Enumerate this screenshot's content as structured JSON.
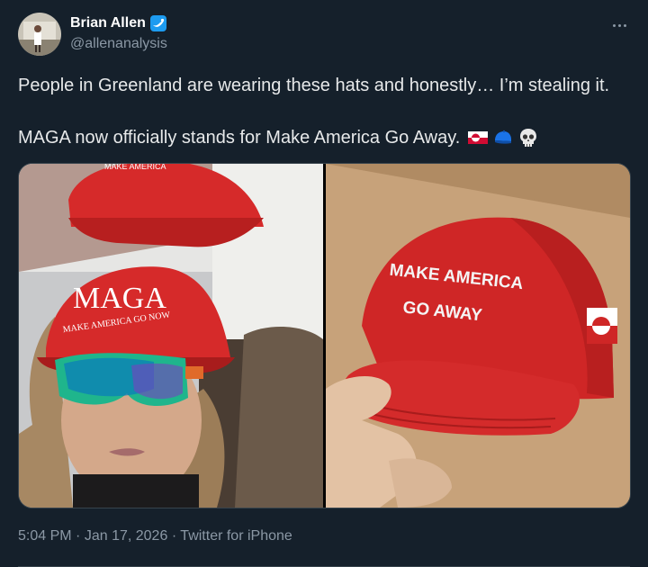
{
  "author": {
    "display_name": "Brian Allen",
    "handle": "@allenanalysis",
    "verified_icon": "verified-badge-icon",
    "accent": "#1d9bf0"
  },
  "tweet": {
    "line1": "People in Greenland are wearing these hats and honestly… I’m stealing it.",
    "line2": "MAGA now officially stands for Make America Go Away.",
    "emojis": [
      "greenland-flag-icon",
      "blue-cap-icon",
      "skull-icon"
    ]
  },
  "media": {
    "left_photo": {
      "hat_text_big": "MAGA",
      "hat_text_small": "MAKE AMERICA GO NOW"
    },
    "right_photo": {
      "hat_line1": "MAKE AMERICA",
      "hat_line2": "GO AWAY"
    }
  },
  "footer": {
    "time": "5:04 PM",
    "date": "Jan 17, 2026",
    "separator": "·",
    "source": "Twitter for iPhone"
  },
  "colors": {
    "background": "#15202b",
    "text": "#e7e9ea",
    "muted": "#8b98a5",
    "hat_red": "#d62a2a"
  }
}
